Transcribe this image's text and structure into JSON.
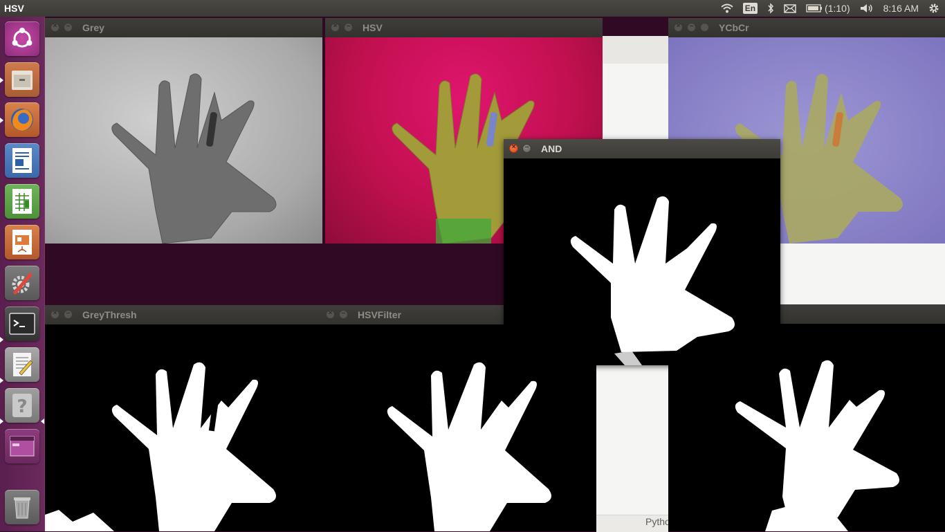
{
  "top_panel": {
    "app_title": "HSV",
    "keyboard_layout": "En",
    "battery_text": "(1:10)",
    "clock": "8:16 AM",
    "icons": [
      "wifi-icon",
      "keyboard-layout-icon",
      "bluetooth-icon",
      "mail-icon",
      "battery-icon",
      "volume-icon",
      "gear-icon"
    ]
  },
  "launcher": {
    "items": [
      {
        "name": "ubuntu-dash",
        "icon": "ubuntu-logo-icon"
      },
      {
        "name": "files",
        "icon": "file-cabinet-icon"
      },
      {
        "name": "firefox",
        "icon": "firefox-icon"
      },
      {
        "name": "libreoffice-writer",
        "icon": "writer-document-icon"
      },
      {
        "name": "libreoffice-calc",
        "icon": "calc-spreadsheet-icon"
      },
      {
        "name": "libreoffice-impress",
        "icon": "impress-presentation-icon"
      },
      {
        "name": "system-settings",
        "icon": "settings-wrench-icon"
      },
      {
        "name": "terminal",
        "icon": "terminal-icon"
      },
      {
        "name": "text-editor",
        "icon": "text-editor-icon"
      },
      {
        "name": "help",
        "icon": "question-mark-icon"
      },
      {
        "name": "workspace-switcher",
        "icon": "workspace-icon"
      },
      {
        "name": "trash",
        "icon": "trash-icon"
      }
    ]
  },
  "windows": {
    "grey": {
      "title": "Grey"
    },
    "hsv": {
      "title": "HSV"
    },
    "ycbcr": {
      "title": "YCbCr"
    },
    "and": {
      "title": "AND"
    },
    "grey_thresh": {
      "title": "GreyThresh"
    },
    "hsv_filter": {
      "title": "HSVFilter"
    }
  },
  "background_app": {
    "partial_label": "Pytho"
  },
  "colors": {
    "desktop": "#300a24",
    "launcher": "#5e2050",
    "titlebar": "#3c3b37",
    "close_button": "#e0561f",
    "hsv_frame": "#c8104f",
    "ycbcr_frame": "#8b83c8",
    "grey_frame": "#b4b4b4"
  }
}
